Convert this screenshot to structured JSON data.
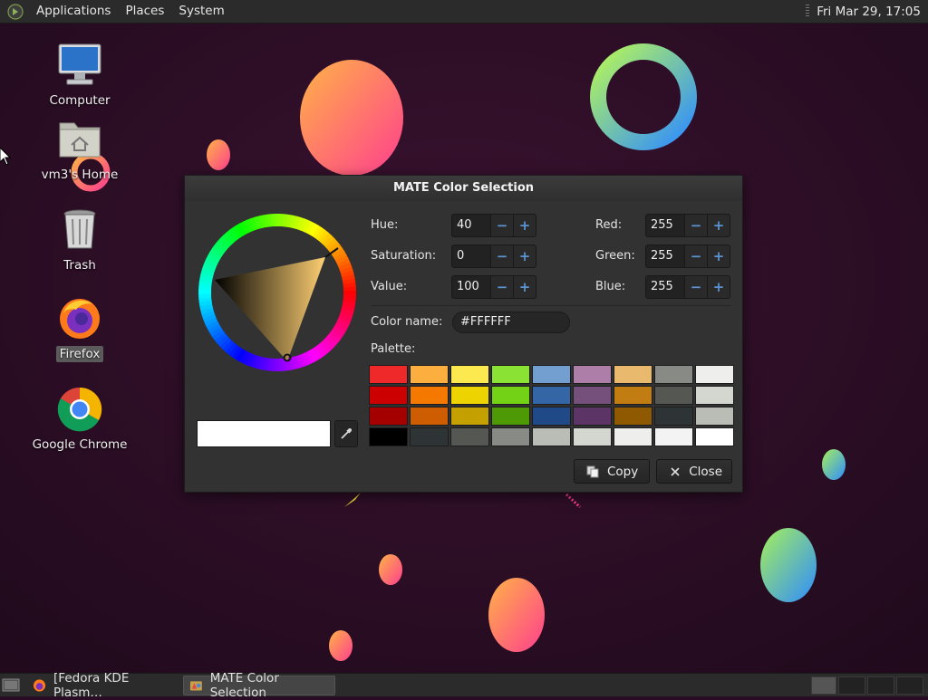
{
  "top_panel": {
    "menus": [
      "Applications",
      "Places",
      "System"
    ],
    "clock": "Fri Mar 29, 17:05"
  },
  "desktop": {
    "icons": [
      {
        "label": "Computer",
        "icon": "computer-icon"
      },
      {
        "label": "vm3's Home",
        "icon": "home-folder-icon"
      },
      {
        "label": "Trash",
        "icon": "trash-icon"
      },
      {
        "label": "Firefox",
        "icon": "firefox-icon"
      },
      {
        "label": "Google Chrome",
        "icon": "chrome-icon"
      }
    ]
  },
  "dialog": {
    "title": "MATE Color Selection",
    "hsv": {
      "hue_label": "Hue:",
      "hue": "40",
      "saturation_label": "Saturation:",
      "saturation": "0",
      "value_label": "Value:",
      "value": "100"
    },
    "rgb": {
      "red_label": "Red:",
      "red": "255",
      "green_label": "Green:",
      "green": "255",
      "blue_label": "Blue:",
      "blue": "255"
    },
    "color_name_label": "Color name:",
    "color_name": "#FFFFFF",
    "palette_label": "Palette:",
    "palette": [
      "#ef2929",
      "#fcaf3e",
      "#fce94f",
      "#8ae234",
      "#729fcf",
      "#ad7fa8",
      "#e9b96e",
      "#888a85",
      "#eeeeec",
      "#cc0000",
      "#f57900",
      "#edd400",
      "#73d216",
      "#3465a4",
      "#75507b",
      "#c17d11",
      "#555753",
      "#d3d7cf",
      "#a40000",
      "#ce5c00",
      "#c4a000",
      "#4e9a06",
      "#204a87",
      "#5c3566",
      "#8f5902",
      "#2e3436",
      "#babdb6",
      "#000000",
      "#2e3436",
      "#555753",
      "#888a85",
      "#babdb6",
      "#d3d7cf",
      "#eeeeec",
      "#f3f3f3",
      "#ffffff"
    ],
    "current_color": "#ffffff",
    "copy_label": "Copy",
    "close_label": "Close"
  },
  "taskbar": {
    "tasks": [
      {
        "label": "[Fedora KDE Plasm…",
        "active": false
      },
      {
        "label": "MATE Color Selection",
        "active": true
      }
    ]
  },
  "colors": {
    "panel_bg": "#2b2b2b",
    "dialog_bg": "#323232",
    "accent": "#5a93cf",
    "wallpaper_bg": "#2a0d24"
  }
}
